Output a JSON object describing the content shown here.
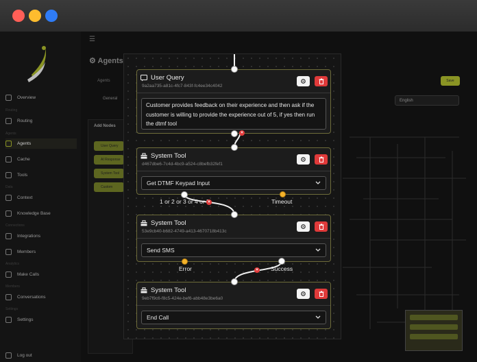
{
  "window": {
    "controls": [
      {
        "color": "#ff5f57"
      },
      {
        "color": "#febc2e"
      },
      {
        "color": "#2f7cf6"
      }
    ]
  },
  "app": {
    "page_title": "Agents",
    "breadcrumb": "Agents",
    "tab_general": "General",
    "save_label": "Save",
    "language": "English"
  },
  "sidebar": {
    "sections": [
      "Routing",
      "Agents",
      "Data",
      "Connections",
      "Members",
      "Analytics",
      "Settings"
    ],
    "items": [
      {
        "label": "Overview"
      },
      {
        "label": "Routing"
      },
      {
        "label": "Agents"
      },
      {
        "label": "Cache"
      },
      {
        "label": "Tools"
      },
      {
        "label": "Context"
      },
      {
        "label": "Knowledge Base"
      },
      {
        "label": "Integrations"
      },
      {
        "label": "Members"
      },
      {
        "label": "Make Calls"
      },
      {
        "label": "Conversations"
      },
      {
        "label": "Settings"
      },
      {
        "label": "Log out"
      }
    ]
  },
  "add_nodes": {
    "title": "Add Nodes",
    "buttons": [
      "User Query",
      "AI Response",
      "System Tool",
      "Custom"
    ]
  },
  "nodes": [
    {
      "title": "User Query",
      "id": "9a2aa735-a81c-4fc7-843f-fc4ee34c4042",
      "prompt": "Customer provides feedback on their experience and then ask if the customer is willing to provide the experience out of 5, if yes then run the dtmf tool"
    },
    {
      "title": "System Tool",
      "id": "d467dbe6-7c4d-4bc9-a524-c8befb32fef1",
      "selected": "Get DTMF Keypad Input",
      "outputs": [
        "1 or 2 or 3 or 4 or 5",
        "Timeout"
      ]
    },
    {
      "title": "System Tool",
      "id": "53e9cb40-b682-4749-a413-4670718b413c",
      "selected": "Send SMS",
      "outputs": [
        "Error",
        "Success"
      ]
    },
    {
      "title": "System Tool",
      "id": "9eb7f9c6-f8c5-424e-bef6-abb48e3be6a0",
      "selected": "End Call"
    }
  ],
  "icons": {
    "user_query": "chat-icon",
    "system_tool": "toolbox-icon",
    "settings": "gear-icon",
    "delete": "trash-icon",
    "dropdown": "chevron-down-icon",
    "remove_edge": "close-icon"
  },
  "colors": {
    "accent": "#8a9424",
    "node_border": "#6e6c3a",
    "delete": "#e03a3a",
    "handle_yellow": "#f4b22a"
  }
}
